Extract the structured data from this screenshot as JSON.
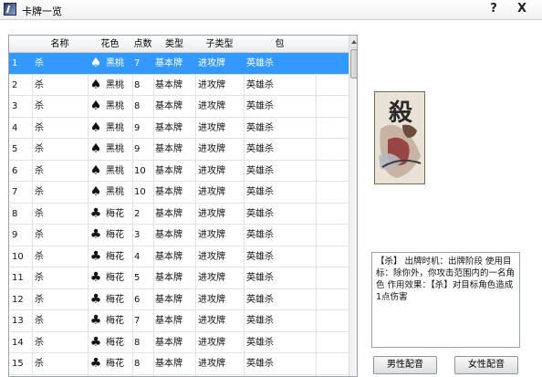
{
  "window": {
    "title": "卡牌一览",
    "help_label": "?",
    "close_label": "X"
  },
  "table": {
    "columns": [
      "",
      "名称",
      "花色",
      "点数",
      "类型",
      "子类型",
      "包"
    ],
    "rows": [
      {
        "idx": "1",
        "name": "杀",
        "suit_icon": "♠",
        "suit": "黑桃",
        "num": "7",
        "type": "基本牌",
        "sub": "进攻牌",
        "pack": "英雄杀",
        "selected": true
      },
      {
        "idx": "2",
        "name": "杀",
        "suit_icon": "♠",
        "suit": "黑桃",
        "num": "8",
        "type": "基本牌",
        "sub": "进攻牌",
        "pack": "英雄杀"
      },
      {
        "idx": "3",
        "name": "杀",
        "suit_icon": "♠",
        "suit": "黑桃",
        "num": "8",
        "type": "基本牌",
        "sub": "进攻牌",
        "pack": "英雄杀"
      },
      {
        "idx": "4",
        "name": "杀",
        "suit_icon": "♠",
        "suit": "黑桃",
        "num": "9",
        "type": "基本牌",
        "sub": "进攻牌",
        "pack": "英雄杀"
      },
      {
        "idx": "5",
        "name": "杀",
        "suit_icon": "♠",
        "suit": "黑桃",
        "num": "9",
        "type": "基本牌",
        "sub": "进攻牌",
        "pack": "英雄杀"
      },
      {
        "idx": "6",
        "name": "杀",
        "suit_icon": "♠",
        "suit": "黑桃",
        "num": "10",
        "type": "基本牌",
        "sub": "进攻牌",
        "pack": "英雄杀"
      },
      {
        "idx": "7",
        "name": "杀",
        "suit_icon": "♠",
        "suit": "黑桃",
        "num": "10",
        "type": "基本牌",
        "sub": "进攻牌",
        "pack": "英雄杀"
      },
      {
        "idx": "8",
        "name": "杀",
        "suit_icon": "♣",
        "suit": "梅花",
        "num": "2",
        "type": "基本牌",
        "sub": "进攻牌",
        "pack": "英雄杀"
      },
      {
        "idx": "9",
        "name": "杀",
        "suit_icon": "♣",
        "suit": "梅花",
        "num": "3",
        "type": "基本牌",
        "sub": "进攻牌",
        "pack": "英雄杀"
      },
      {
        "idx": "10",
        "name": "杀",
        "suit_icon": "♣",
        "suit": "梅花",
        "num": "4",
        "type": "基本牌",
        "sub": "进攻牌",
        "pack": "英雄杀"
      },
      {
        "idx": "11",
        "name": "杀",
        "suit_icon": "♣",
        "suit": "梅花",
        "num": "5",
        "type": "基本牌",
        "sub": "进攻牌",
        "pack": "英雄杀"
      },
      {
        "idx": "12",
        "name": "杀",
        "suit_icon": "♣",
        "suit": "梅花",
        "num": "6",
        "type": "基本牌",
        "sub": "进攻牌",
        "pack": "英雄杀"
      },
      {
        "idx": "13",
        "name": "杀",
        "suit_icon": "♣",
        "suit": "梅花",
        "num": "7",
        "type": "基本牌",
        "sub": "进攻牌",
        "pack": "英雄杀"
      },
      {
        "idx": "14",
        "name": "杀",
        "suit_icon": "♣",
        "suit": "梅花",
        "num": "8",
        "type": "基本牌",
        "sub": "进攻牌",
        "pack": "英雄杀"
      },
      {
        "idx": "15",
        "name": "杀",
        "suit_icon": "♣",
        "suit": "梅花",
        "num": "8",
        "type": "基本牌",
        "sub": "进攻牌",
        "pack": "英雄杀"
      }
    ]
  },
  "card_preview": {
    "glyph": "殺"
  },
  "description": "【杀】 出牌时机：出牌阶段 使用目标：除你外，你攻击范围内的一名角色 作用效果：【杀】对目标角色造成1点伤害",
  "buttons": {
    "male_voice": "男性配音",
    "female_voice": "女性配音"
  },
  "colors": {
    "selection": "#3399ff",
    "grid_border": "#9aa3ad"
  }
}
